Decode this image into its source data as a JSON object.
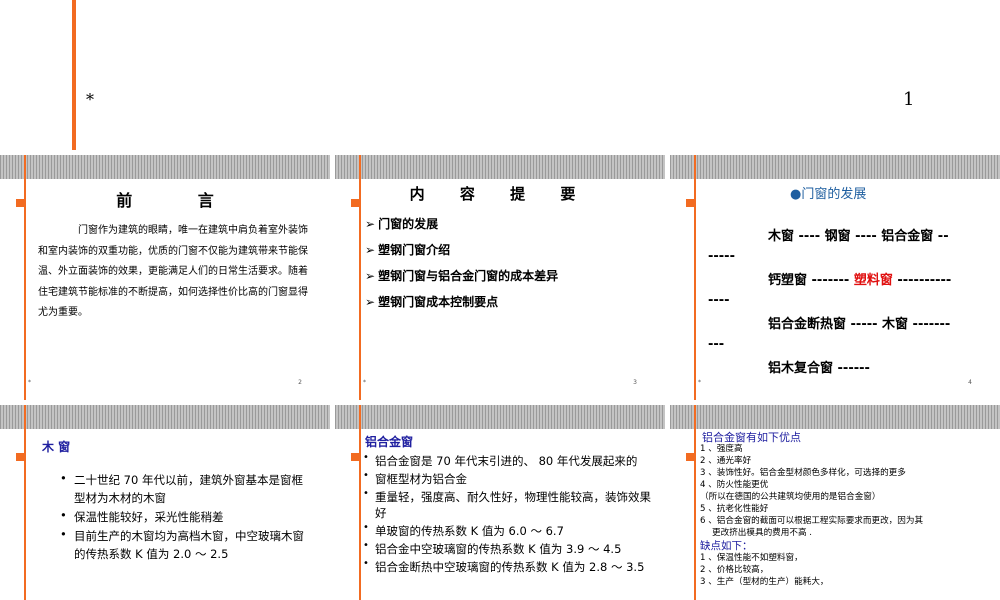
{
  "top": {
    "star": "*",
    "page_number": "1"
  },
  "slides": [
    {
      "title": "前 言",
      "body": "门窗作为建筑的眼睛，唯一在建筑中肩负着室外装饰和室内装饰的双重功能，优质的门窗不仅能为建筑带来节能保温、外立面装饰的效果，更能满足人们的日常生活要求。随着住宅建筑节能标准的不断提高，如何选择性价比高的门窗显得尤为重要。",
      "footer_star": "*",
      "page": "2"
    },
    {
      "title": "内 容 提 要",
      "items": [
        "门窗的发展",
        "塑钢门窗介绍",
        "塑钢门窗与铝合金门窗的成本差异",
        "塑钢门窗成本控制要点"
      ],
      "arrow": "➢",
      "footer_star": "*",
      "page": "3"
    },
    {
      "title": "●门窗的发展",
      "line1": "木窗 ---- 钢窗 ---- 铝合金窗 -------",
      "line2_a": "钙塑窗 ------- ",
      "line2_red": "塑料窗",
      "line2_b": " --------------",
      "line3": "铝合金断热窗 ----- 木窗 ----------",
      "line4": "铝木复合窗 ------",
      "footer_star": "*",
      "page": "4"
    },
    {
      "title": "木 窗",
      "items": [
        "二十世纪 70 年代以前，建筑外窗基本是窗框型材为木材的木窗",
        "保温性能较好，采光性能稍差",
        "目前生产的木窗均为高档木窗，中空玻璃木窗的传热系数 K 值为 2.0 ～ 2.5"
      ]
    },
    {
      "title": "铝合金窗",
      "items": [
        "铝合金窗是 70 年代末引进的、 80 年代发展起来的",
        "窗框型材为铝合金",
        "重量轻，强度高、耐久性好，物理性能较高，装饰效果好",
        "单玻窗的传热系数 K 值为 6.0 ～ 6.7",
        "铝合金中空玻璃窗的传热系数 K 值为 3.9 ～ 4.5",
        "铝合金断热中空玻璃窗的传热系数 K 值为 2.8 ～ 3.5"
      ]
    },
    {
      "title": "铝合金窗有如下优点",
      "advantages": [
        "1 、强度高",
        "2 、通光率好",
        "3 、装饰性好。铝合金型材颜色多样化，可选择的更多",
        "4 、防火性能更优",
        "（所以在德国的公共建筑均使用的是铝合金窗）",
        "5 、抗老化性能好",
        "6 、铝合金窗的截面可以根据工程实际要求而更改，因为其",
        "更改挤出模具的费用不高 ."
      ],
      "disadvantage_title": "缺点如下：",
      "disadvantages": [
        "1 、保温性能不如塑料窗，",
        "2 、价格比较高，",
        "3 、生产（型材的生产）能耗大，"
      ]
    }
  ]
}
